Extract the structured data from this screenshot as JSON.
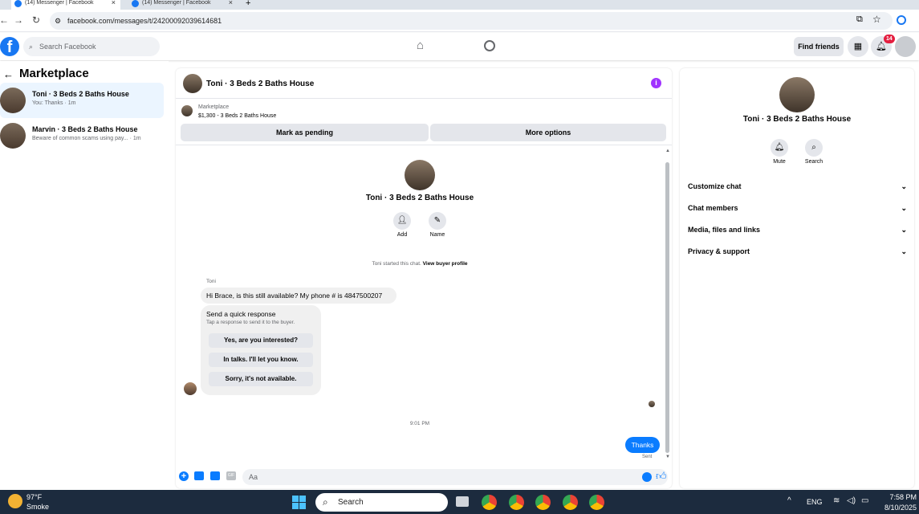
{
  "browser": {
    "tabs": [
      {
        "title": "(14) Messenger | Facebook"
      },
      {
        "title": "(14) Messenger | Facebook"
      }
    ],
    "url": "facebook.com/messages/t/242000920396146​81"
  },
  "fb_header": {
    "search_placeholder": "Search Facebook",
    "find_friends": "Find friends",
    "notification_count": "14"
  },
  "left": {
    "title": "Marketplace",
    "conversations": [
      {
        "name": "Toni · 3 Beds 2 Baths House",
        "preview": "You: Thanks · 1m"
      },
      {
        "name": "Marvin · 3 Beds 2 Baths House",
        "preview": "Beware of common scams using pay... · 1m"
      }
    ]
  },
  "chat": {
    "header_title": "Toni · 3 Beds 2 Baths House",
    "listing_source": "Marketplace",
    "listing_price_title": "$1,300 - 3 Beds 2 Baths House",
    "mark_pending": "Mark as pending",
    "more_options": "More options",
    "intro_title": "Toni · 3 Beds 2 Baths House",
    "add_label": "Add",
    "name_label": "Name",
    "started_text": "Toni started this chat.",
    "view_profile": "View buyer profile",
    "sender_name": "Toni",
    "incoming_message": "Hi Brace, is this still available? My phone # is 4847500207",
    "quick_title": "Send a quick response",
    "quick_sub": "Tap a response to send it to the buyer.",
    "quick_replies": [
      "Yes, are you interested?",
      "In talks. I'll let you know.",
      "Sorry, it's not available."
    ],
    "timestamp": "9:01 PM",
    "outgoing_message": "Thanks",
    "sent_status": "Sent",
    "composer_placeholder": "Aa"
  },
  "right": {
    "title": "Toni · 3 Beds 2 Baths House",
    "mute": "Mute",
    "search": "Search",
    "sections": [
      "Customize chat",
      "Chat members",
      "Media, files and links",
      "Privacy & support"
    ]
  },
  "taskbar": {
    "weather_temp": "97°F",
    "weather_desc": "Smoke",
    "search": "Search",
    "lang": "ENG",
    "time": "7:58 PM",
    "date": "8/10/2025"
  },
  "colors": {
    "fb_blue": "#1877f2",
    "badge_red": "#e41e3f",
    "info_purple": "#a033ff"
  }
}
